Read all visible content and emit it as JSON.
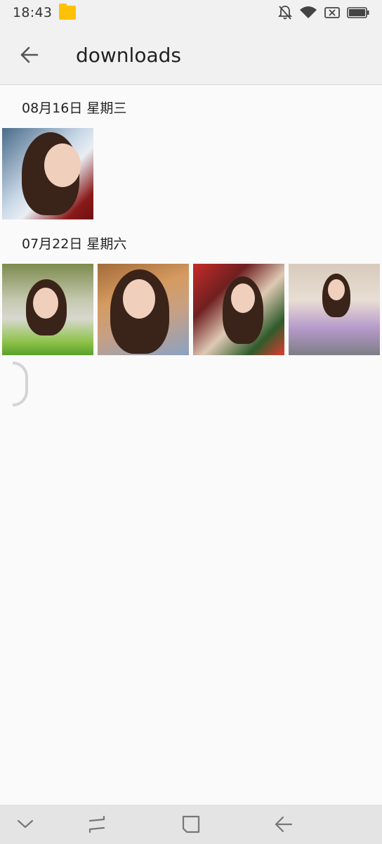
{
  "status_bar": {
    "time": "18:43",
    "icons": [
      "folder-icon",
      "bell-off-icon",
      "wifi-icon",
      "no-sim-icon",
      "battery-icon"
    ]
  },
  "app_bar": {
    "title": "downloads",
    "back_icon": "arrow-left-icon"
  },
  "sections": [
    {
      "date": "08月16日 星期三",
      "photos": [
        "photo-1"
      ]
    },
    {
      "date": "07月22日 星期六",
      "photos": [
        "photo-2",
        "photo-3",
        "photo-4",
        "photo-5"
      ]
    }
  ],
  "nav_bar": {
    "icons": [
      "chevron-down-icon",
      "recents-icon",
      "home-icon",
      "back-icon"
    ]
  },
  "colors": {
    "folder": "#ffc107",
    "background": "#fafafa",
    "bar": "#f1f1f1",
    "nav": "#e4e4e4"
  }
}
